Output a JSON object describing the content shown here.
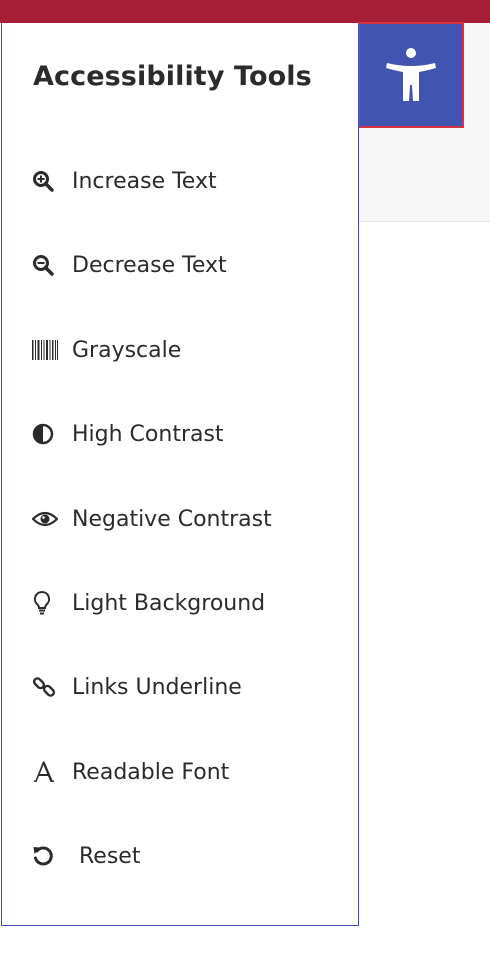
{
  "panel": {
    "title": "Accessibility Tools",
    "items": [
      {
        "label": "Increase Text",
        "icon": "zoom-in-icon"
      },
      {
        "label": "Decrease Text",
        "icon": "zoom-out-icon"
      },
      {
        "label": "Grayscale",
        "icon": "barcode-icon"
      },
      {
        "label": "High Contrast",
        "icon": "contrast-icon"
      },
      {
        "label": "Negative Contrast",
        "icon": "eye-icon"
      },
      {
        "label": "Light Background",
        "icon": "lightbulb-icon"
      },
      {
        "label": "Links Underline",
        "icon": "link-icon"
      },
      {
        "label": "Readable Font",
        "icon": "font-icon"
      },
      {
        "label": "Reset",
        "icon": "reset-icon"
      }
    ]
  },
  "toggle": {
    "icon": "accessibility-person-icon"
  },
  "colors": {
    "top_bar": "#a51e36",
    "toggle_bg": "#4154b0",
    "toggle_border": "#d6333f",
    "panel_border": "#3f4fae",
    "text": "#2b2b2b"
  }
}
